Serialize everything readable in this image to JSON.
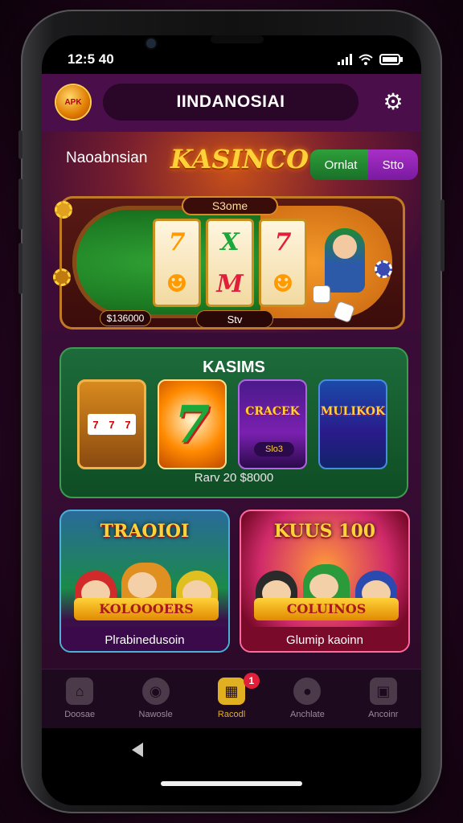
{
  "status_bar": {
    "time": "12:5 40"
  },
  "header": {
    "logo_text": "APK",
    "region_title": "IINDANOSIAI"
  },
  "hero": {
    "left_label": "Naoabnsian",
    "title": "KASINCO",
    "btn_primary": "Ornlat",
    "btn_secondary": "Stto",
    "table_label": "S3ome",
    "table_left_tag": "$136000",
    "table_mid_tag": "Stv"
  },
  "games_panel": {
    "title": "KASIMS",
    "tiles": [
      {
        "name": "slot-machine",
        "text": ""
      },
      {
        "name": "seven",
        "text": "7"
      },
      {
        "name": "cracker",
        "text": "CRACEK",
        "sub": "Slo3"
      },
      {
        "name": "multi",
        "text": "MULIKOK"
      }
    ],
    "footer": "Rarv 20 $8000"
  },
  "promos": [
    {
      "title": "TRAOIOI",
      "banner": "KOLOOOERS",
      "label": "Plrabinedusoin"
    },
    {
      "title": "KUUS 100",
      "banner": "COLUINOS",
      "label": "Glumip kaoinn"
    }
  ],
  "bottom_nav": [
    {
      "label": "Doosae",
      "icon": "home-icon",
      "active": false
    },
    {
      "label": "Nawosle",
      "icon": "globe-icon",
      "active": false
    },
    {
      "label": "Racodl",
      "icon": "gift-icon",
      "active": true,
      "badge": "1"
    },
    {
      "label": "Anchlate",
      "icon": "user-icon",
      "active": false
    },
    {
      "label": "Ancoinr",
      "icon": "wallet-icon",
      "active": false
    }
  ]
}
